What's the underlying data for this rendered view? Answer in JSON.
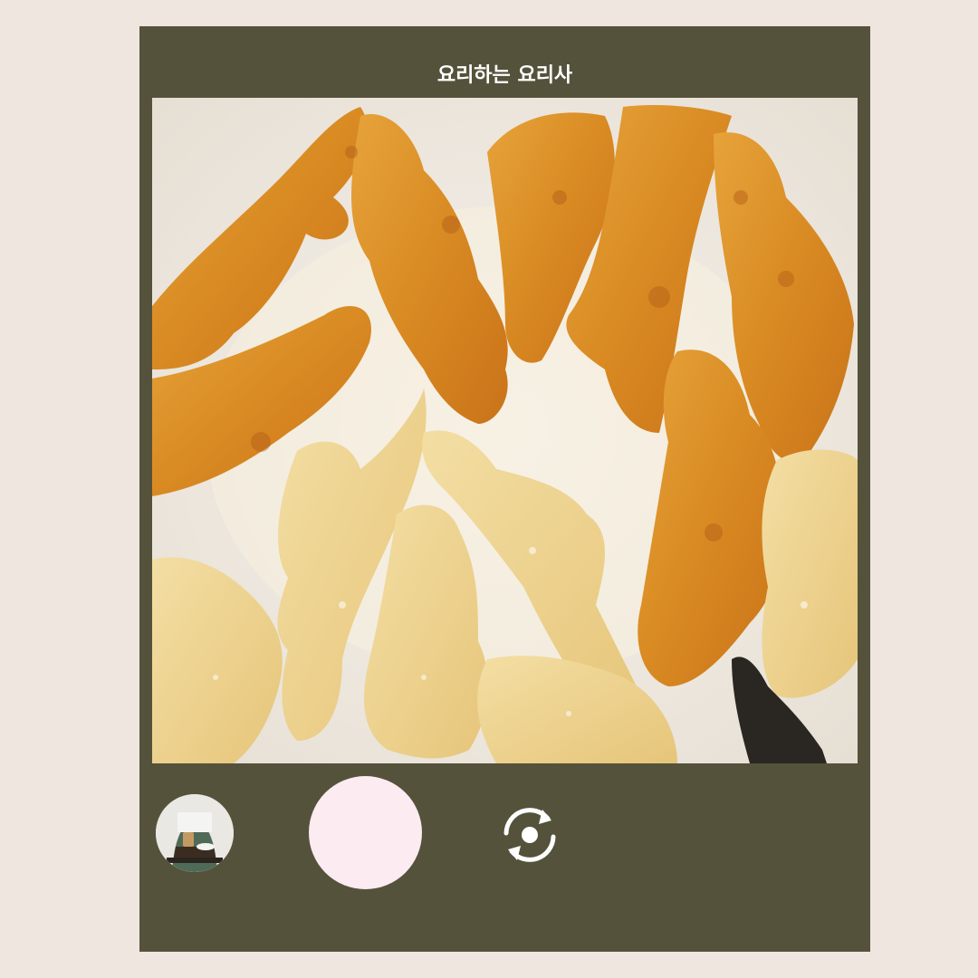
{
  "header": {
    "title": "요리하는 요리사"
  },
  "viewfinder": {
    "subject": "dinosaur-nuggets-frying-in-pan"
  },
  "controls": {
    "gallery_icon": "gallery-thumbnail-icon",
    "shutter_icon": "shutter-icon",
    "switch_icon": "switch-camera-icon"
  },
  "colors": {
    "page_background": "#efe6e0",
    "panel": "#55523c",
    "shutter": "#fcebf0",
    "icon": "#ffffff"
  }
}
